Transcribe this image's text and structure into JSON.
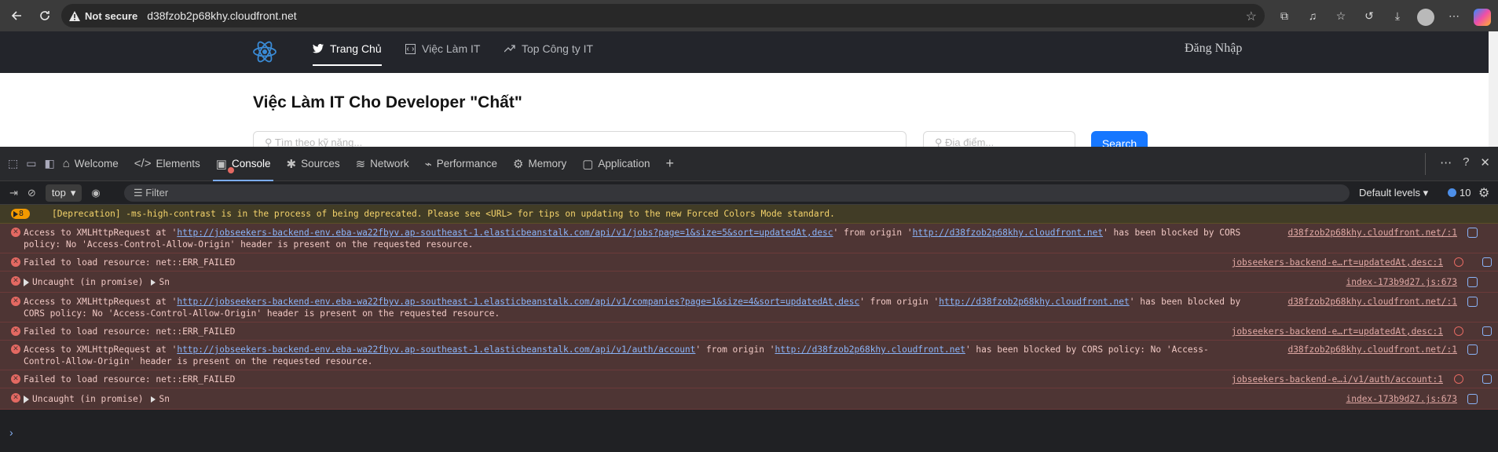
{
  "browser": {
    "security_label": "Not secure",
    "url": "d38fzob2p68khy.cloudfront.net"
  },
  "site": {
    "nav": [
      {
        "label": "Trang Chủ",
        "icon": "twitter-icon"
      },
      {
        "label": "Việc Làm IT",
        "icon": "code-icon"
      },
      {
        "label": "Top Công ty IT",
        "icon": "rise-icon"
      }
    ],
    "login_label": "Đăng Nhập",
    "hero_title": "Việc Làm IT Cho Developer \"Chất\"",
    "skill_placeholder": "Tìm theo kỹ năng...",
    "location_placeholder": "Địa điểm...",
    "search_label": "Search"
  },
  "devtools": {
    "tabs": [
      {
        "label": "Welcome",
        "icon": "home-icon"
      },
      {
        "label": "Elements",
        "icon": "code-icon"
      },
      {
        "label": "Console",
        "icon": "console-icon"
      },
      {
        "label": "Sources",
        "icon": "bug-icon"
      },
      {
        "label": "Network",
        "icon": "wifi-icon"
      },
      {
        "label": "Performance",
        "icon": "performance-icon"
      },
      {
        "label": "Memory",
        "icon": "memory-icon"
      },
      {
        "label": "Application",
        "icon": "application-icon"
      }
    ],
    "active_tab": "Console",
    "context": "top",
    "filter_placeholder": "Filter",
    "levels_label": "Default levels",
    "issues_count": "10"
  },
  "console": {
    "warning": {
      "count": "8",
      "text": "[Deprecation] -ms-high-contrast is in the process of being deprecated. Please see <URL> for tips on updating to the new Forced Colors Mode standard."
    },
    "messages": [
      {
        "type": "cors",
        "pre": "Access to XMLHttpRequest at '",
        "link": "http://jobseekers-backend-env.eba-wa22fbyv.ap-southeast-1.elasticbeanstalk.com/api/v1/jobs?page=1&size=5&sort=updatedAt,desc",
        "mid": "' from origin '",
        "origin": "http://d38fzob2p68khy.cloudfront.net",
        "post": "' has been blocked by CORS policy: No 'Access-Control-Allow-Origin' header is present on the requested resource.",
        "source": "d38fzob2p68khy.cloudfront.net/:1"
      },
      {
        "type": "failed",
        "text": "Failed to load resource: net::ERR_FAILED",
        "source": "jobseekers-backend-e…rt=updatedAt,desc:1"
      },
      {
        "type": "uncaught",
        "text": "Uncaught (in promise)",
        "obj": "Sn",
        "source": "index-173b9d27.js:673"
      },
      {
        "type": "cors",
        "pre": "Access to XMLHttpRequest at '",
        "link": "http://jobseekers-backend-env.eba-wa22fbyv.ap-southeast-1.elasticbeanstalk.com/api/v1/companies?page=1&size=4&sort=updatedAt,desc",
        "mid": "' from origin '",
        "origin": "http://d38fzob2p68khy.cloudfront.net",
        "post": "' has been blocked by CORS policy: No 'Access-Control-Allow-Origin' header is present on the requested resource.",
        "source": "d38fzob2p68khy.cloudfront.net/:1"
      },
      {
        "type": "failed",
        "text": "Failed to load resource: net::ERR_FAILED",
        "source": "jobseekers-backend-e…rt=updatedAt,desc:1"
      },
      {
        "type": "cors",
        "pre": "Access to XMLHttpRequest at '",
        "link": "http://jobseekers-backend-env.eba-wa22fbyv.ap-southeast-1.elasticbeanstalk.com/api/v1/auth/account",
        "mid": "' from origin '",
        "origin": "http://d38fzob2p68khy.cloudfront.net",
        "post": "' has been blocked by CORS policy: No 'Access-Control-Allow-Origin' header is present on the requested resource.",
        "source": "d38fzob2p68khy.cloudfront.net/:1"
      },
      {
        "type": "failed",
        "text": "Failed to load resource: net::ERR_FAILED",
        "source": "jobseekers-backend-e…i/v1/auth/account:1"
      },
      {
        "type": "uncaught",
        "text": "Uncaught (in promise)",
        "obj": "Sn",
        "source": "index-173b9d27.js:673"
      }
    ],
    "prompt": "›"
  },
  "colors": {
    "error_bg": "#4e3534",
    "warning_bg": "#413c26",
    "link": "#8ab4f8",
    "search_button": "#1677ff"
  }
}
